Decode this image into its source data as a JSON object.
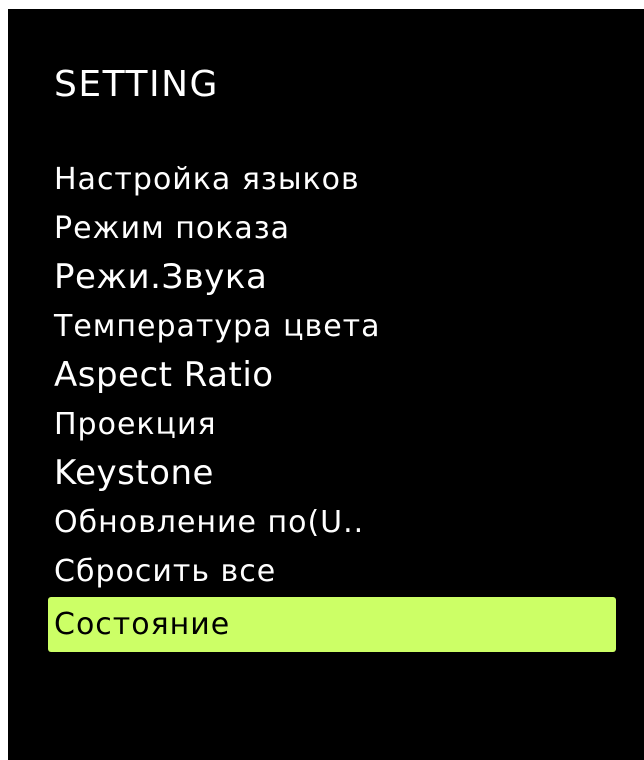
{
  "colors": {
    "background": "#000000",
    "text": "#ffffff",
    "highlight": "#ccff66",
    "highlight_text": "#000000"
  },
  "menu": {
    "title": "SETTING",
    "items": [
      {
        "label": "Настройка языков",
        "selected": false
      },
      {
        "label": "Режим показа",
        "selected": false
      },
      {
        "label": "Режи.Звука",
        "selected": false
      },
      {
        "label": "Температура цвета",
        "selected": false
      },
      {
        "label": "Aspect Ratio",
        "selected": false
      },
      {
        "label": "Проекция",
        "selected": false
      },
      {
        "label": "Keystone",
        "selected": false
      },
      {
        "label": "Обновление по(U..",
        "selected": false
      },
      {
        "label": "Сбросить все",
        "selected": false
      },
      {
        "label": "Состояние",
        "selected": true
      }
    ]
  }
}
